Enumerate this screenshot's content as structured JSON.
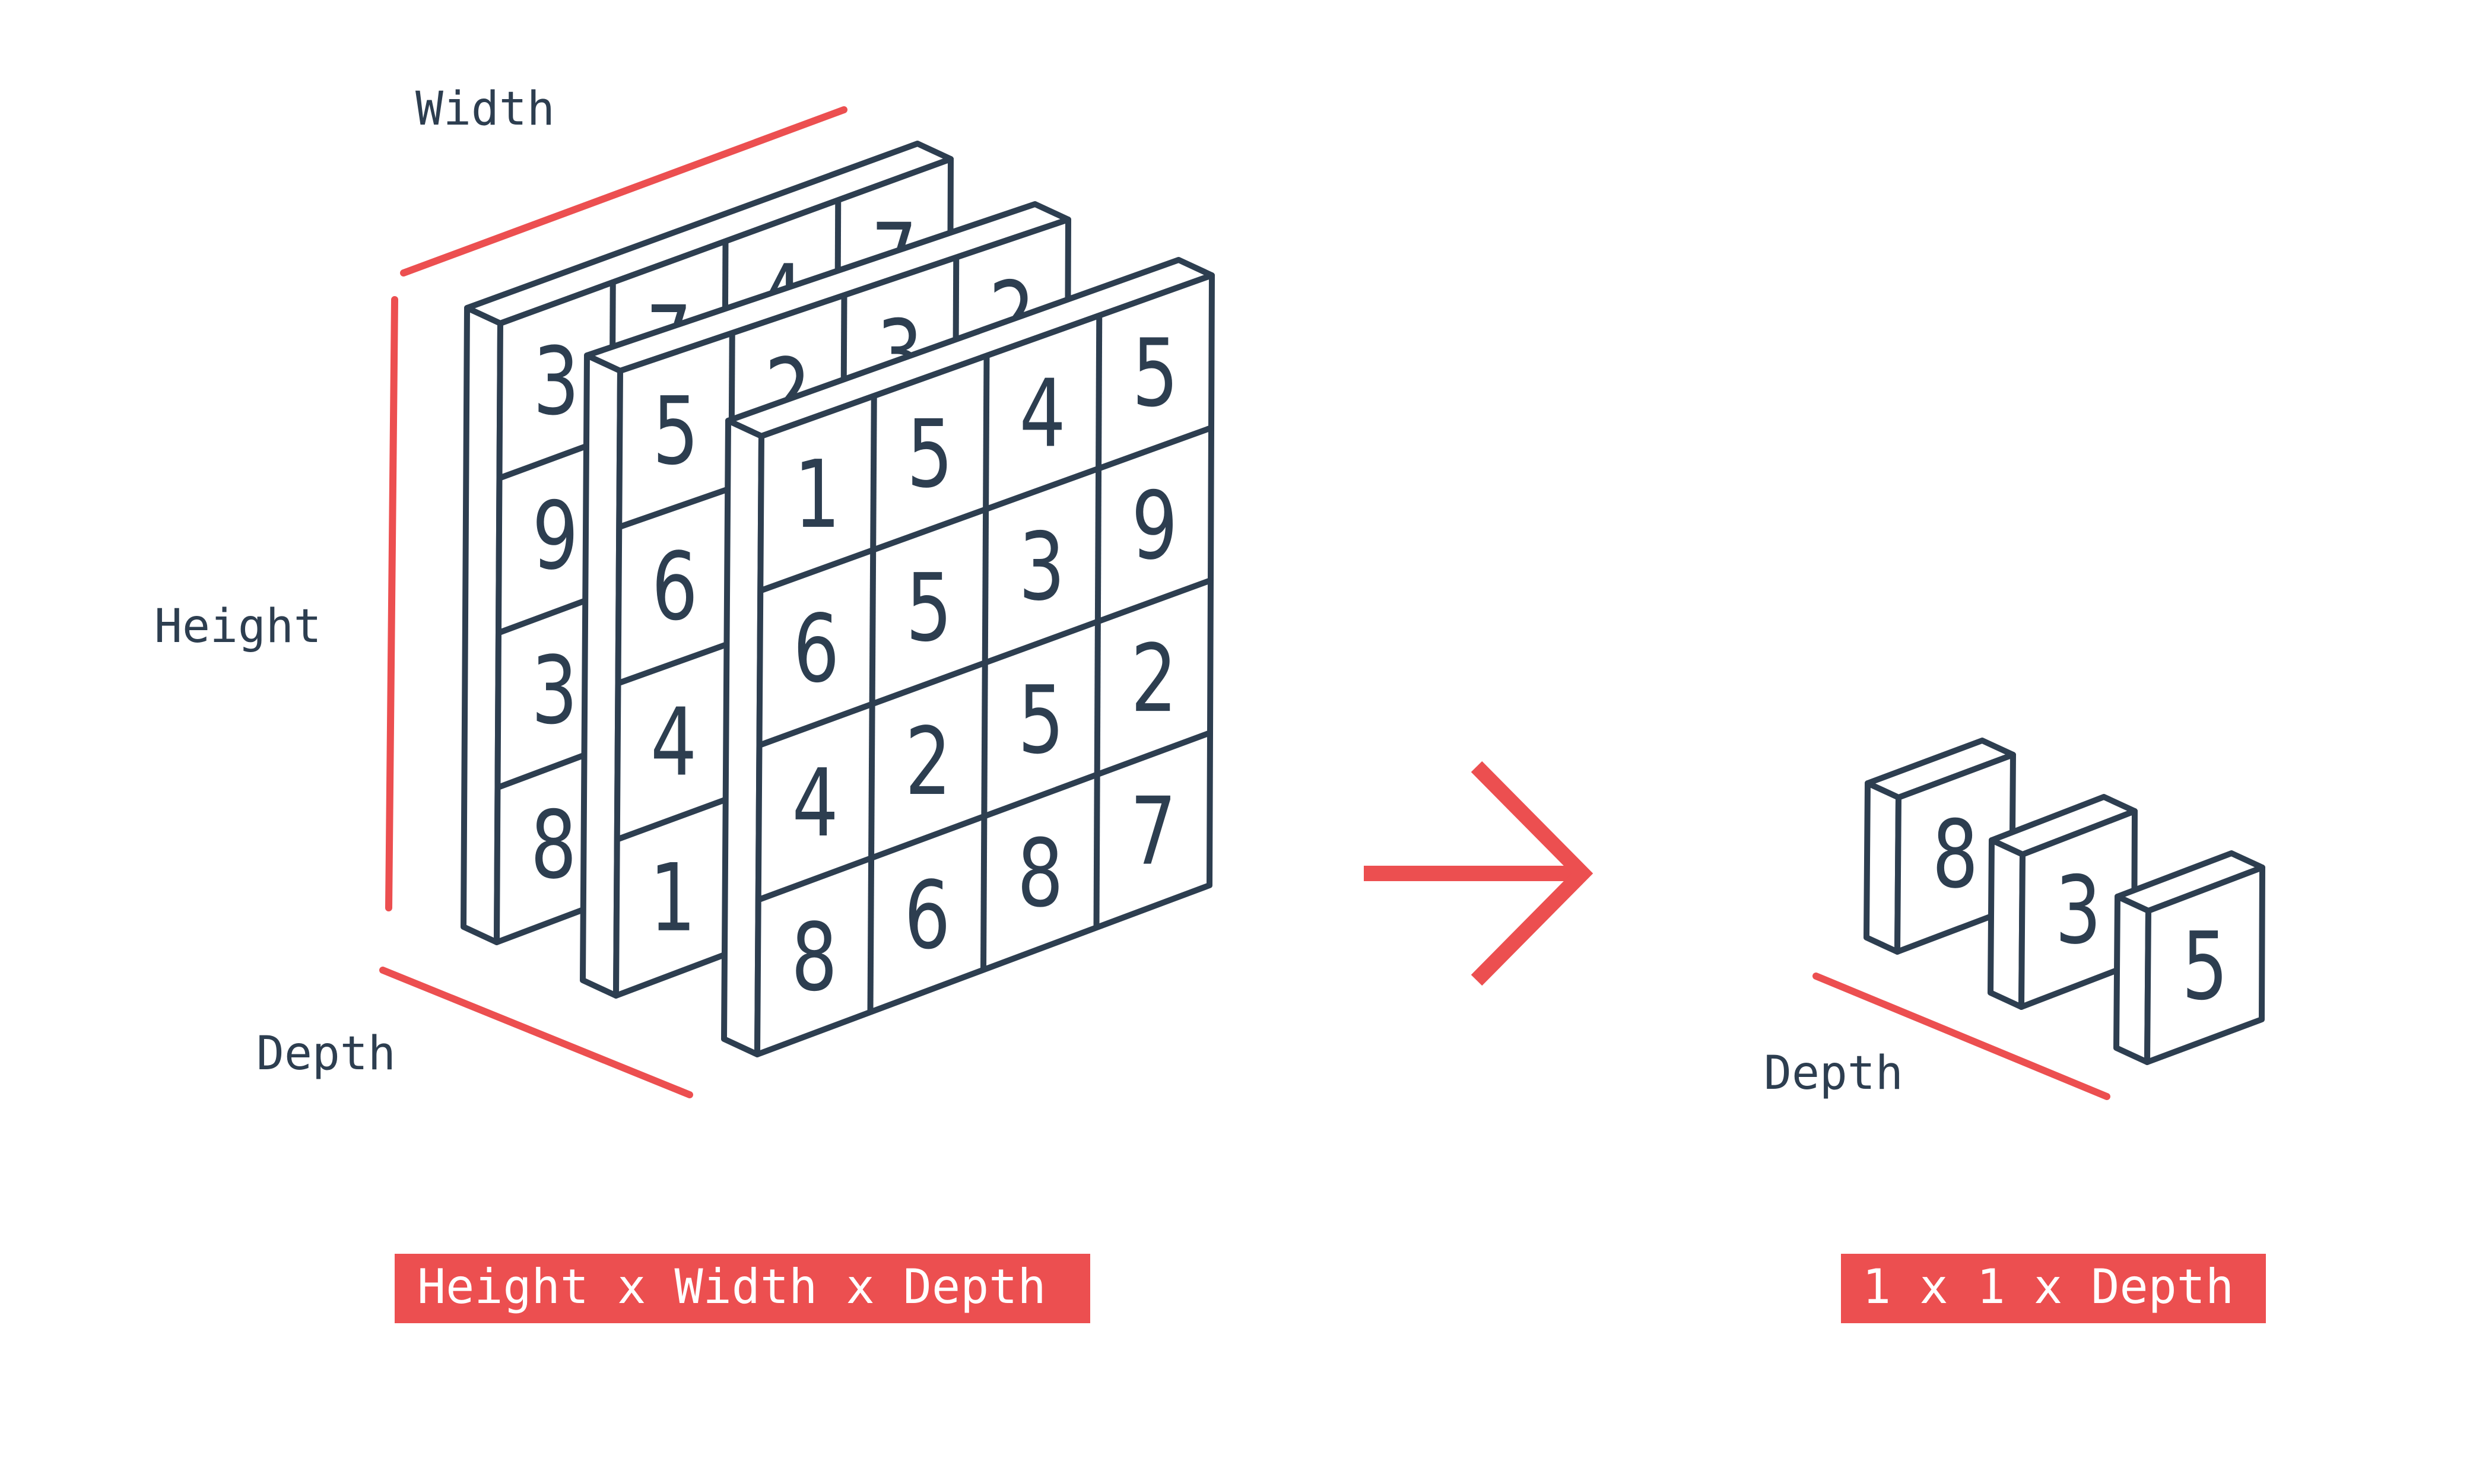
{
  "colors": {
    "ink": "#2d3e50",
    "accent": "#ec4f50",
    "background": "#ffffff",
    "label_text": "#ffffff"
  },
  "labels": {
    "width": "Width",
    "height": "Height",
    "depth_left": "Depth",
    "depth_right": "Depth",
    "input_shape": "Height x Width x Depth",
    "output_shape": "1 x 1 x Depth"
  },
  "input_volume": {
    "slices": [
      {
        "grid": [
          [
            "3",
            "7",
            "4",
            "7"
          ],
          [
            "9",
            "",
            "",
            ""
          ],
          [
            "3",
            "",
            "",
            ""
          ],
          [
            "8",
            "",
            "",
            ""
          ]
        ]
      },
      {
        "grid": [
          [
            "5",
            "2",
            "3",
            "2"
          ],
          [
            "6",
            "",
            "",
            ""
          ],
          [
            "4",
            "",
            "",
            ""
          ],
          [
            "1",
            "",
            "",
            ""
          ]
        ]
      },
      {
        "grid": [
          [
            "1",
            "5",
            "4",
            "5"
          ],
          [
            "6",
            "5",
            "3",
            "9"
          ],
          [
            "4",
            "2",
            "5",
            "2"
          ],
          [
            "8",
            "6",
            "8",
            "7"
          ]
        ]
      }
    ]
  },
  "output_volume": {
    "values": [
      "8",
      "3",
      "5"
    ]
  },
  "arrow_icon": "arrow-right-icon"
}
